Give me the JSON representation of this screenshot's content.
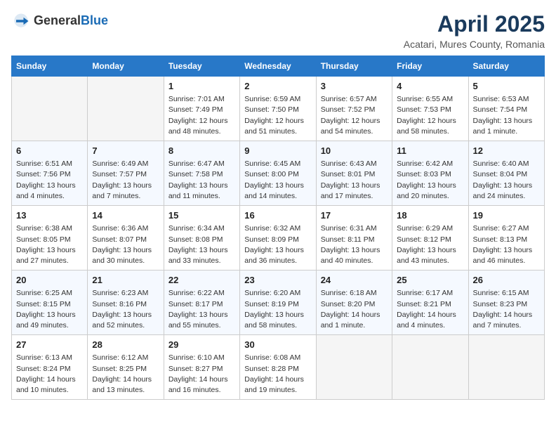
{
  "header": {
    "logo_general": "General",
    "logo_blue": "Blue",
    "month_title": "April 2025",
    "location": "Acatari, Mures County, Romania"
  },
  "columns": [
    "Sunday",
    "Monday",
    "Tuesday",
    "Wednesday",
    "Thursday",
    "Friday",
    "Saturday"
  ],
  "weeks": [
    [
      {
        "day": "",
        "empty": true
      },
      {
        "day": "",
        "empty": true
      },
      {
        "day": "1",
        "sunrise": "Sunrise: 7:01 AM",
        "sunset": "Sunset: 7:49 PM",
        "daylight": "Daylight: 12 hours and 48 minutes."
      },
      {
        "day": "2",
        "sunrise": "Sunrise: 6:59 AM",
        "sunset": "Sunset: 7:50 PM",
        "daylight": "Daylight: 12 hours and 51 minutes."
      },
      {
        "day": "3",
        "sunrise": "Sunrise: 6:57 AM",
        "sunset": "Sunset: 7:52 PM",
        "daylight": "Daylight: 12 hours and 54 minutes."
      },
      {
        "day": "4",
        "sunrise": "Sunrise: 6:55 AM",
        "sunset": "Sunset: 7:53 PM",
        "daylight": "Daylight: 12 hours and 58 minutes."
      },
      {
        "day": "5",
        "sunrise": "Sunrise: 6:53 AM",
        "sunset": "Sunset: 7:54 PM",
        "daylight": "Daylight: 13 hours and 1 minute."
      }
    ],
    [
      {
        "day": "6",
        "sunrise": "Sunrise: 6:51 AM",
        "sunset": "Sunset: 7:56 PM",
        "daylight": "Daylight: 13 hours and 4 minutes."
      },
      {
        "day": "7",
        "sunrise": "Sunrise: 6:49 AM",
        "sunset": "Sunset: 7:57 PM",
        "daylight": "Daylight: 13 hours and 7 minutes."
      },
      {
        "day": "8",
        "sunrise": "Sunrise: 6:47 AM",
        "sunset": "Sunset: 7:58 PM",
        "daylight": "Daylight: 13 hours and 11 minutes."
      },
      {
        "day": "9",
        "sunrise": "Sunrise: 6:45 AM",
        "sunset": "Sunset: 8:00 PM",
        "daylight": "Daylight: 13 hours and 14 minutes."
      },
      {
        "day": "10",
        "sunrise": "Sunrise: 6:43 AM",
        "sunset": "Sunset: 8:01 PM",
        "daylight": "Daylight: 13 hours and 17 minutes."
      },
      {
        "day": "11",
        "sunrise": "Sunrise: 6:42 AM",
        "sunset": "Sunset: 8:03 PM",
        "daylight": "Daylight: 13 hours and 20 minutes."
      },
      {
        "day": "12",
        "sunrise": "Sunrise: 6:40 AM",
        "sunset": "Sunset: 8:04 PM",
        "daylight": "Daylight: 13 hours and 24 minutes."
      }
    ],
    [
      {
        "day": "13",
        "sunrise": "Sunrise: 6:38 AM",
        "sunset": "Sunset: 8:05 PM",
        "daylight": "Daylight: 13 hours and 27 minutes."
      },
      {
        "day": "14",
        "sunrise": "Sunrise: 6:36 AM",
        "sunset": "Sunset: 8:07 PM",
        "daylight": "Daylight: 13 hours and 30 minutes."
      },
      {
        "day": "15",
        "sunrise": "Sunrise: 6:34 AM",
        "sunset": "Sunset: 8:08 PM",
        "daylight": "Daylight: 13 hours and 33 minutes."
      },
      {
        "day": "16",
        "sunrise": "Sunrise: 6:32 AM",
        "sunset": "Sunset: 8:09 PM",
        "daylight": "Daylight: 13 hours and 36 minutes."
      },
      {
        "day": "17",
        "sunrise": "Sunrise: 6:31 AM",
        "sunset": "Sunset: 8:11 PM",
        "daylight": "Daylight: 13 hours and 40 minutes."
      },
      {
        "day": "18",
        "sunrise": "Sunrise: 6:29 AM",
        "sunset": "Sunset: 8:12 PM",
        "daylight": "Daylight: 13 hours and 43 minutes."
      },
      {
        "day": "19",
        "sunrise": "Sunrise: 6:27 AM",
        "sunset": "Sunset: 8:13 PM",
        "daylight": "Daylight: 13 hours and 46 minutes."
      }
    ],
    [
      {
        "day": "20",
        "sunrise": "Sunrise: 6:25 AM",
        "sunset": "Sunset: 8:15 PM",
        "daylight": "Daylight: 13 hours and 49 minutes."
      },
      {
        "day": "21",
        "sunrise": "Sunrise: 6:23 AM",
        "sunset": "Sunset: 8:16 PM",
        "daylight": "Daylight: 13 hours and 52 minutes."
      },
      {
        "day": "22",
        "sunrise": "Sunrise: 6:22 AM",
        "sunset": "Sunset: 8:17 PM",
        "daylight": "Daylight: 13 hours and 55 minutes."
      },
      {
        "day": "23",
        "sunrise": "Sunrise: 6:20 AM",
        "sunset": "Sunset: 8:19 PM",
        "daylight": "Daylight: 13 hours and 58 minutes."
      },
      {
        "day": "24",
        "sunrise": "Sunrise: 6:18 AM",
        "sunset": "Sunset: 8:20 PM",
        "daylight": "Daylight: 14 hours and 1 minute."
      },
      {
        "day": "25",
        "sunrise": "Sunrise: 6:17 AM",
        "sunset": "Sunset: 8:21 PM",
        "daylight": "Daylight: 14 hours and 4 minutes."
      },
      {
        "day": "26",
        "sunrise": "Sunrise: 6:15 AM",
        "sunset": "Sunset: 8:23 PM",
        "daylight": "Daylight: 14 hours and 7 minutes."
      }
    ],
    [
      {
        "day": "27",
        "sunrise": "Sunrise: 6:13 AM",
        "sunset": "Sunset: 8:24 PM",
        "daylight": "Daylight: 14 hours and 10 minutes."
      },
      {
        "day": "28",
        "sunrise": "Sunrise: 6:12 AM",
        "sunset": "Sunset: 8:25 PM",
        "daylight": "Daylight: 14 hours and 13 minutes."
      },
      {
        "day": "29",
        "sunrise": "Sunrise: 6:10 AM",
        "sunset": "Sunset: 8:27 PM",
        "daylight": "Daylight: 14 hours and 16 minutes."
      },
      {
        "day": "30",
        "sunrise": "Sunrise: 6:08 AM",
        "sunset": "Sunset: 8:28 PM",
        "daylight": "Daylight: 14 hours and 19 minutes."
      },
      {
        "day": "",
        "empty": true
      },
      {
        "day": "",
        "empty": true
      },
      {
        "day": "",
        "empty": true
      }
    ]
  ]
}
